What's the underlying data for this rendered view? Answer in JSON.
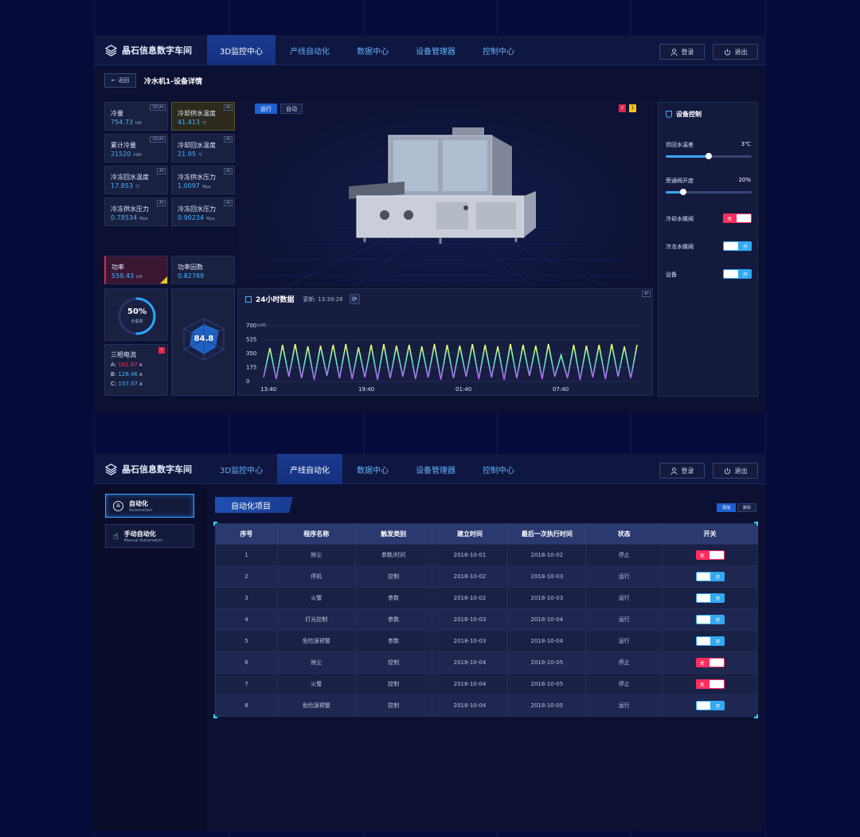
{
  "colors": {
    "accent": "#36a8ff",
    "off": "#ff2d5e",
    "bg": "#070b3a"
  },
  "app": {
    "logo_text": "晶石信息数字车间",
    "nav": [
      "3D监控中心",
      "产线自动化",
      "数据中心",
      "设备管理器",
      "控制中心"
    ],
    "login": "登录",
    "logout": "退出"
  },
  "screen1": {
    "back": "返回",
    "title": "冷水机1-设备详情",
    "metrics": [
      {
        "label": "冷量",
        "value": "754.73",
        "unit": "kW",
        "tag": "3D/AI"
      },
      {
        "label": "冷却供水温度",
        "value": "41.413",
        "unit": "℃",
        "tag": "AI"
      },
      {
        "label": "累计冷量",
        "value": "21520",
        "unit": "kWh",
        "tag": "3D/AI"
      },
      {
        "label": "冷却回水温度",
        "value": "21.95",
        "unit": "℃",
        "tag": "AI"
      },
      {
        "label": "冷冻回水温度",
        "value": "17.853",
        "unit": "℃",
        "tag": "AI"
      },
      {
        "label": "冷冻供水压力",
        "value": "1.0097",
        "unit": "Mpa",
        "tag": "AI"
      },
      {
        "label": "冷冻供水压力",
        "value": "0.78534",
        "unit": "Mpa",
        "tag": "AI"
      },
      {
        "label": "冷冻回水压力",
        "value": "0.90234",
        "unit": "Mpa",
        "tag": "AI"
      }
    ],
    "power": {
      "label": "功率",
      "value": "559.43",
      "unit": "kW"
    },
    "pf": {
      "label": "功率因数",
      "value": "0.82789"
    },
    "load": {
      "value": "50%",
      "label": "负载率",
      "fraction": 0.5
    },
    "current": {
      "title": "三相电流",
      "badge": "!",
      "a_label": "A:",
      "a": "161.87",
      "b_label": "B:",
      "b": "128.46",
      "c_label": "C:",
      "c": "157.07",
      "unit": "A"
    },
    "radar_value": "84.8",
    "modes": [
      "运行",
      "自动"
    ],
    "alerts": [
      "2",
      "1"
    ],
    "chart_title": "24小时数据",
    "chart_update": "更新: 13:39:28",
    "chart_tag": "AI",
    "control": {
      "title": "设备控制",
      "s1_label": "供回水温差",
      "s1_value": "3℃",
      "s1_frac": 0.5,
      "s2_label": "旁通阀开度",
      "s2_value": "20%",
      "s2_frac": 0.2,
      "t1_label": "冷却水蝶阀",
      "t1_state": "关",
      "t2_label": "冷冻水蝶阀",
      "t2_state": "开",
      "t3_label": "设备",
      "t3_state": "开"
    }
  },
  "chart_data": {
    "type": "line",
    "ylabel": "(kW)",
    "yticks": [
      "700",
      "525",
      "350",
      "175",
      "0"
    ],
    "ylim": [
      0,
      700
    ],
    "xticks": [
      "13:40",
      "19:40",
      "01:40",
      "07:40"
    ],
    "grid": true,
    "values": [
      50,
      420,
      30,
      460,
      60,
      470,
      40,
      440,
      20,
      450,
      70,
      460,
      40,
      470,
      30,
      430,
      50,
      460,
      20,
      470,
      40,
      450,
      60,
      460,
      30,
      440,
      50,
      470,
      20,
      460,
      40,
      450,
      60,
      470,
      30,
      460,
      50,
      440,
      20,
      470,
      40,
      460,
      70,
      450,
      30,
      470,
      60,
      330,
      40,
      460,
      20,
      450,
      50,
      460,
      30,
      470,
      60,
      440,
      40,
      460
    ]
  },
  "screen2": {
    "side": [
      {
        "title": "自动化",
        "sub": "Automation"
      },
      {
        "title": "手动自动化",
        "sub": "Manual Automation"
      }
    ],
    "section": "自动化项目",
    "btn_add": "添加",
    "btn_del": "删除",
    "columns": [
      "序号",
      "程序名称",
      "触发类别",
      "建立时间",
      "最后一次执行时间",
      "状态",
      "开关"
    ],
    "rows": [
      {
        "id": "1",
        "name": "除尘",
        "trigger": "参数/时间",
        "created": "2018-10-01",
        "last": "2018-10-02",
        "status": "停止",
        "switch": "关"
      },
      {
        "id": "2",
        "name": "停机",
        "trigger": "控制",
        "created": "2018-10-02",
        "last": "2018-10-03",
        "status": "运行",
        "switch": "开"
      },
      {
        "id": "3",
        "name": "火警",
        "trigger": "参数",
        "created": "2018-10-02",
        "last": "2018-10-03",
        "status": "运行",
        "switch": "开"
      },
      {
        "id": "4",
        "name": "灯光控制",
        "trigger": "参数",
        "created": "2018-10-03",
        "last": "2018-10-04",
        "status": "运行",
        "switch": "开"
      },
      {
        "id": "5",
        "name": "危险源预警",
        "trigger": "参数",
        "created": "2018-10-03",
        "last": "2018-10-04",
        "status": "运行",
        "switch": "开"
      },
      {
        "id": "6",
        "name": "除尘",
        "trigger": "控制",
        "created": "2018-10-04",
        "last": "2018-10-05",
        "status": "停止",
        "switch": "关"
      },
      {
        "id": "7",
        "name": "火警",
        "trigger": "控制",
        "created": "2018-10-04",
        "last": "2018-10-05",
        "status": "停止",
        "switch": "关"
      },
      {
        "id": "8",
        "name": "危险源预警",
        "trigger": "控制",
        "created": "2018-10-04",
        "last": "2018-10-05",
        "status": "运行",
        "switch": "开"
      }
    ]
  }
}
